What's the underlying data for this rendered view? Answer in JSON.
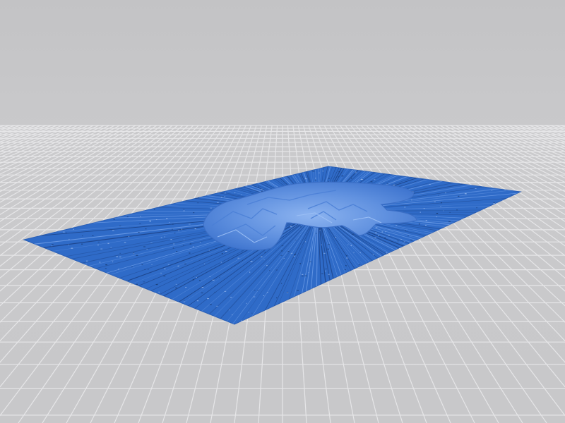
{
  "scene": {
    "background_color": "#c9c9cb",
    "grid_line_color": "#e6e6e8",
    "model_color": "#2f6bc8",
    "model_highlight_color": "#6f9ee8",
    "model_shadow_color": "#1d4c9a"
  }
}
